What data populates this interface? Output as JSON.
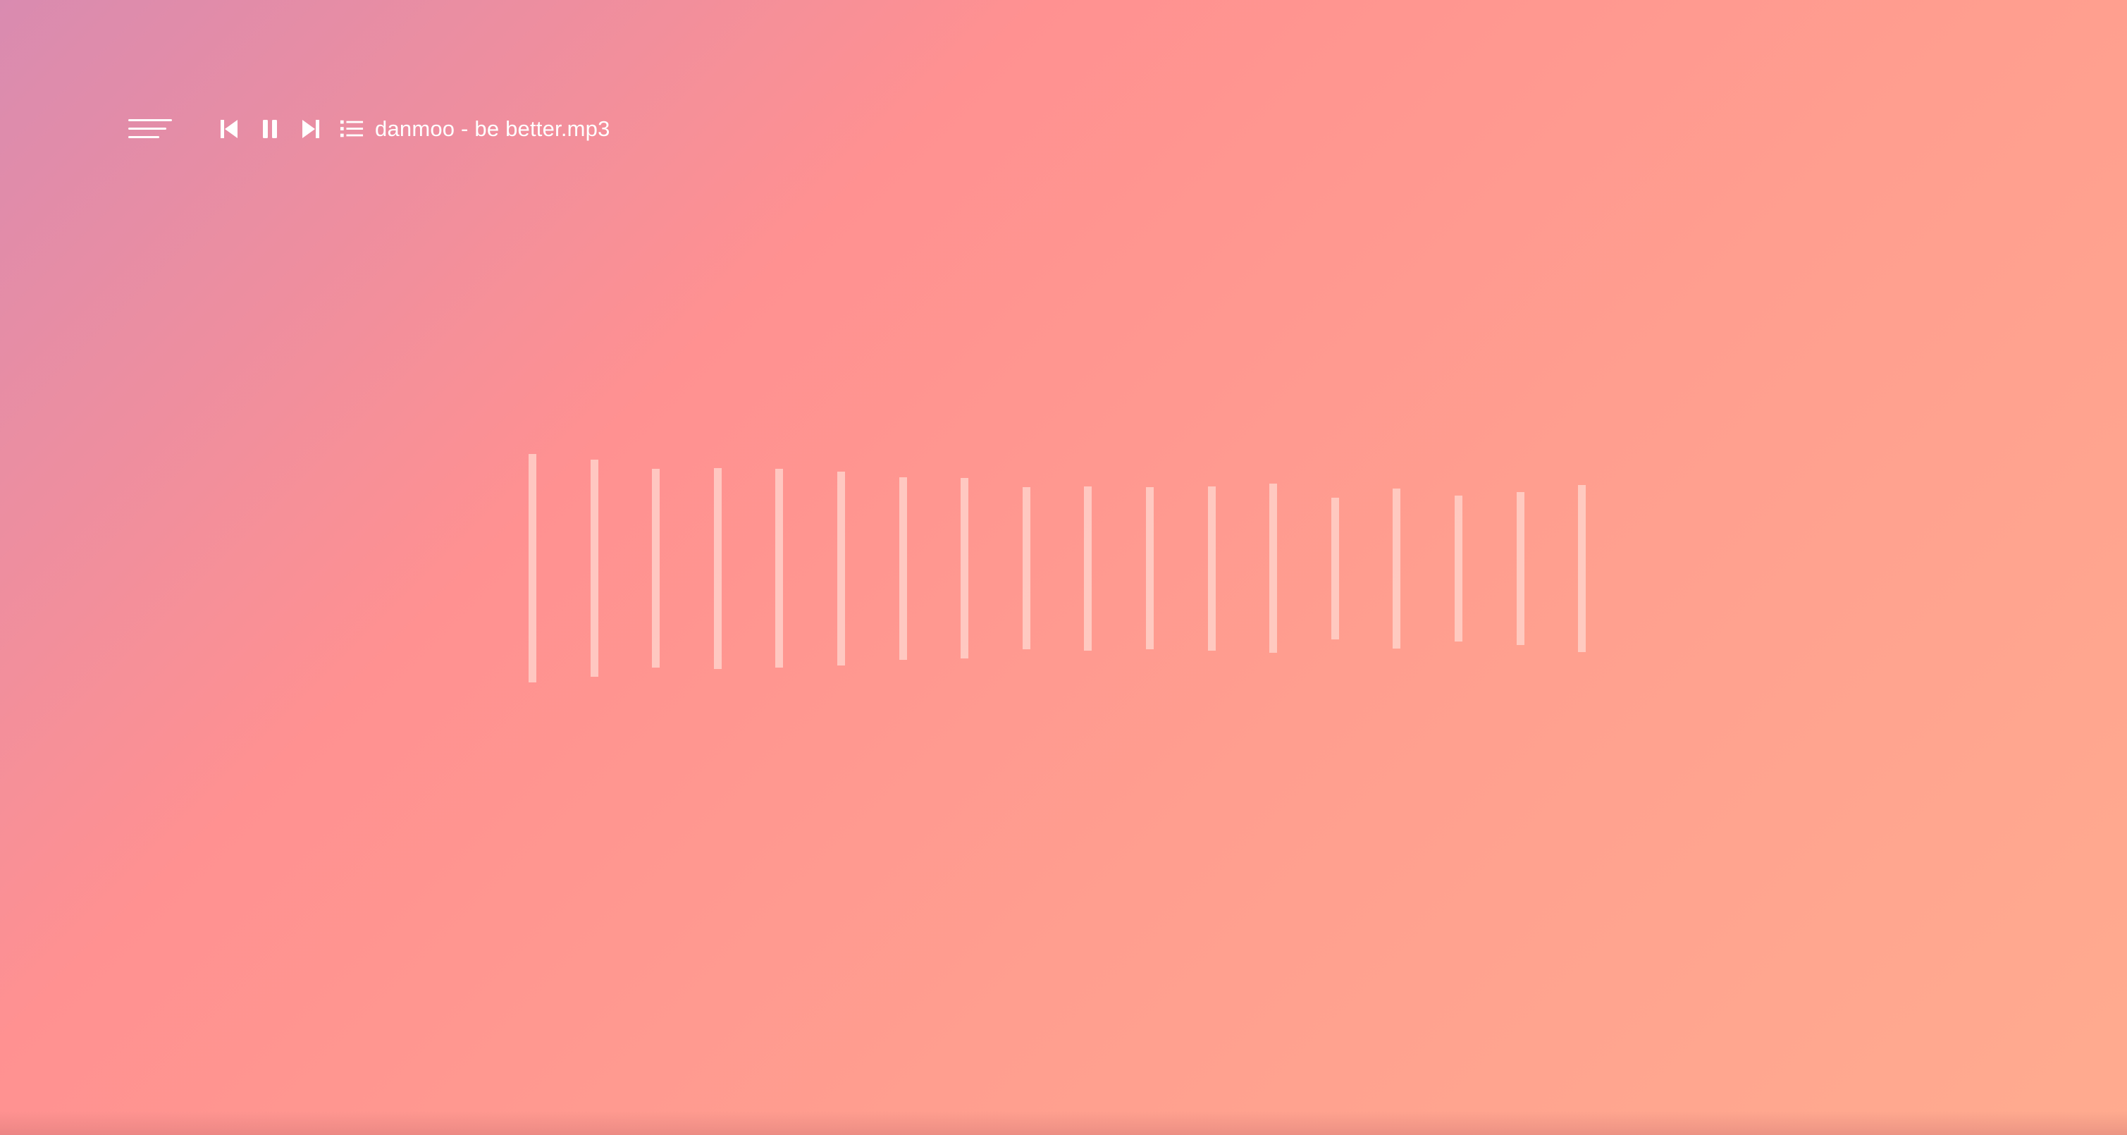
{
  "player": {
    "menu_icon": "hamburger-menu-icon",
    "controls": [
      {
        "name": "previous-track-button",
        "icon": "skip-previous-icon"
      },
      {
        "name": "pause-button",
        "icon": "pause-icon"
      },
      {
        "name": "next-track-button",
        "icon": "skip-next-icon"
      },
      {
        "name": "playlist-button",
        "icon": "playlist-icon"
      }
    ],
    "track_title": "danmoo - be better.mp3"
  },
  "visualizer": {
    "bar_count": 18,
    "levels": [
      1.0,
      0.95,
      0.87,
      0.88,
      0.87,
      0.85,
      0.8,
      0.79,
      0.71,
      0.72,
      0.71,
      0.72,
      0.74,
      0.62,
      0.7,
      0.64,
      0.67,
      0.73
    ]
  },
  "colors": {
    "gradient_start": "#d98bb0",
    "gradient_mid": "#ff9191",
    "gradient_end": "#ffab8f",
    "foreground": "#ffffff",
    "bar_color": "#ffd6ce"
  }
}
